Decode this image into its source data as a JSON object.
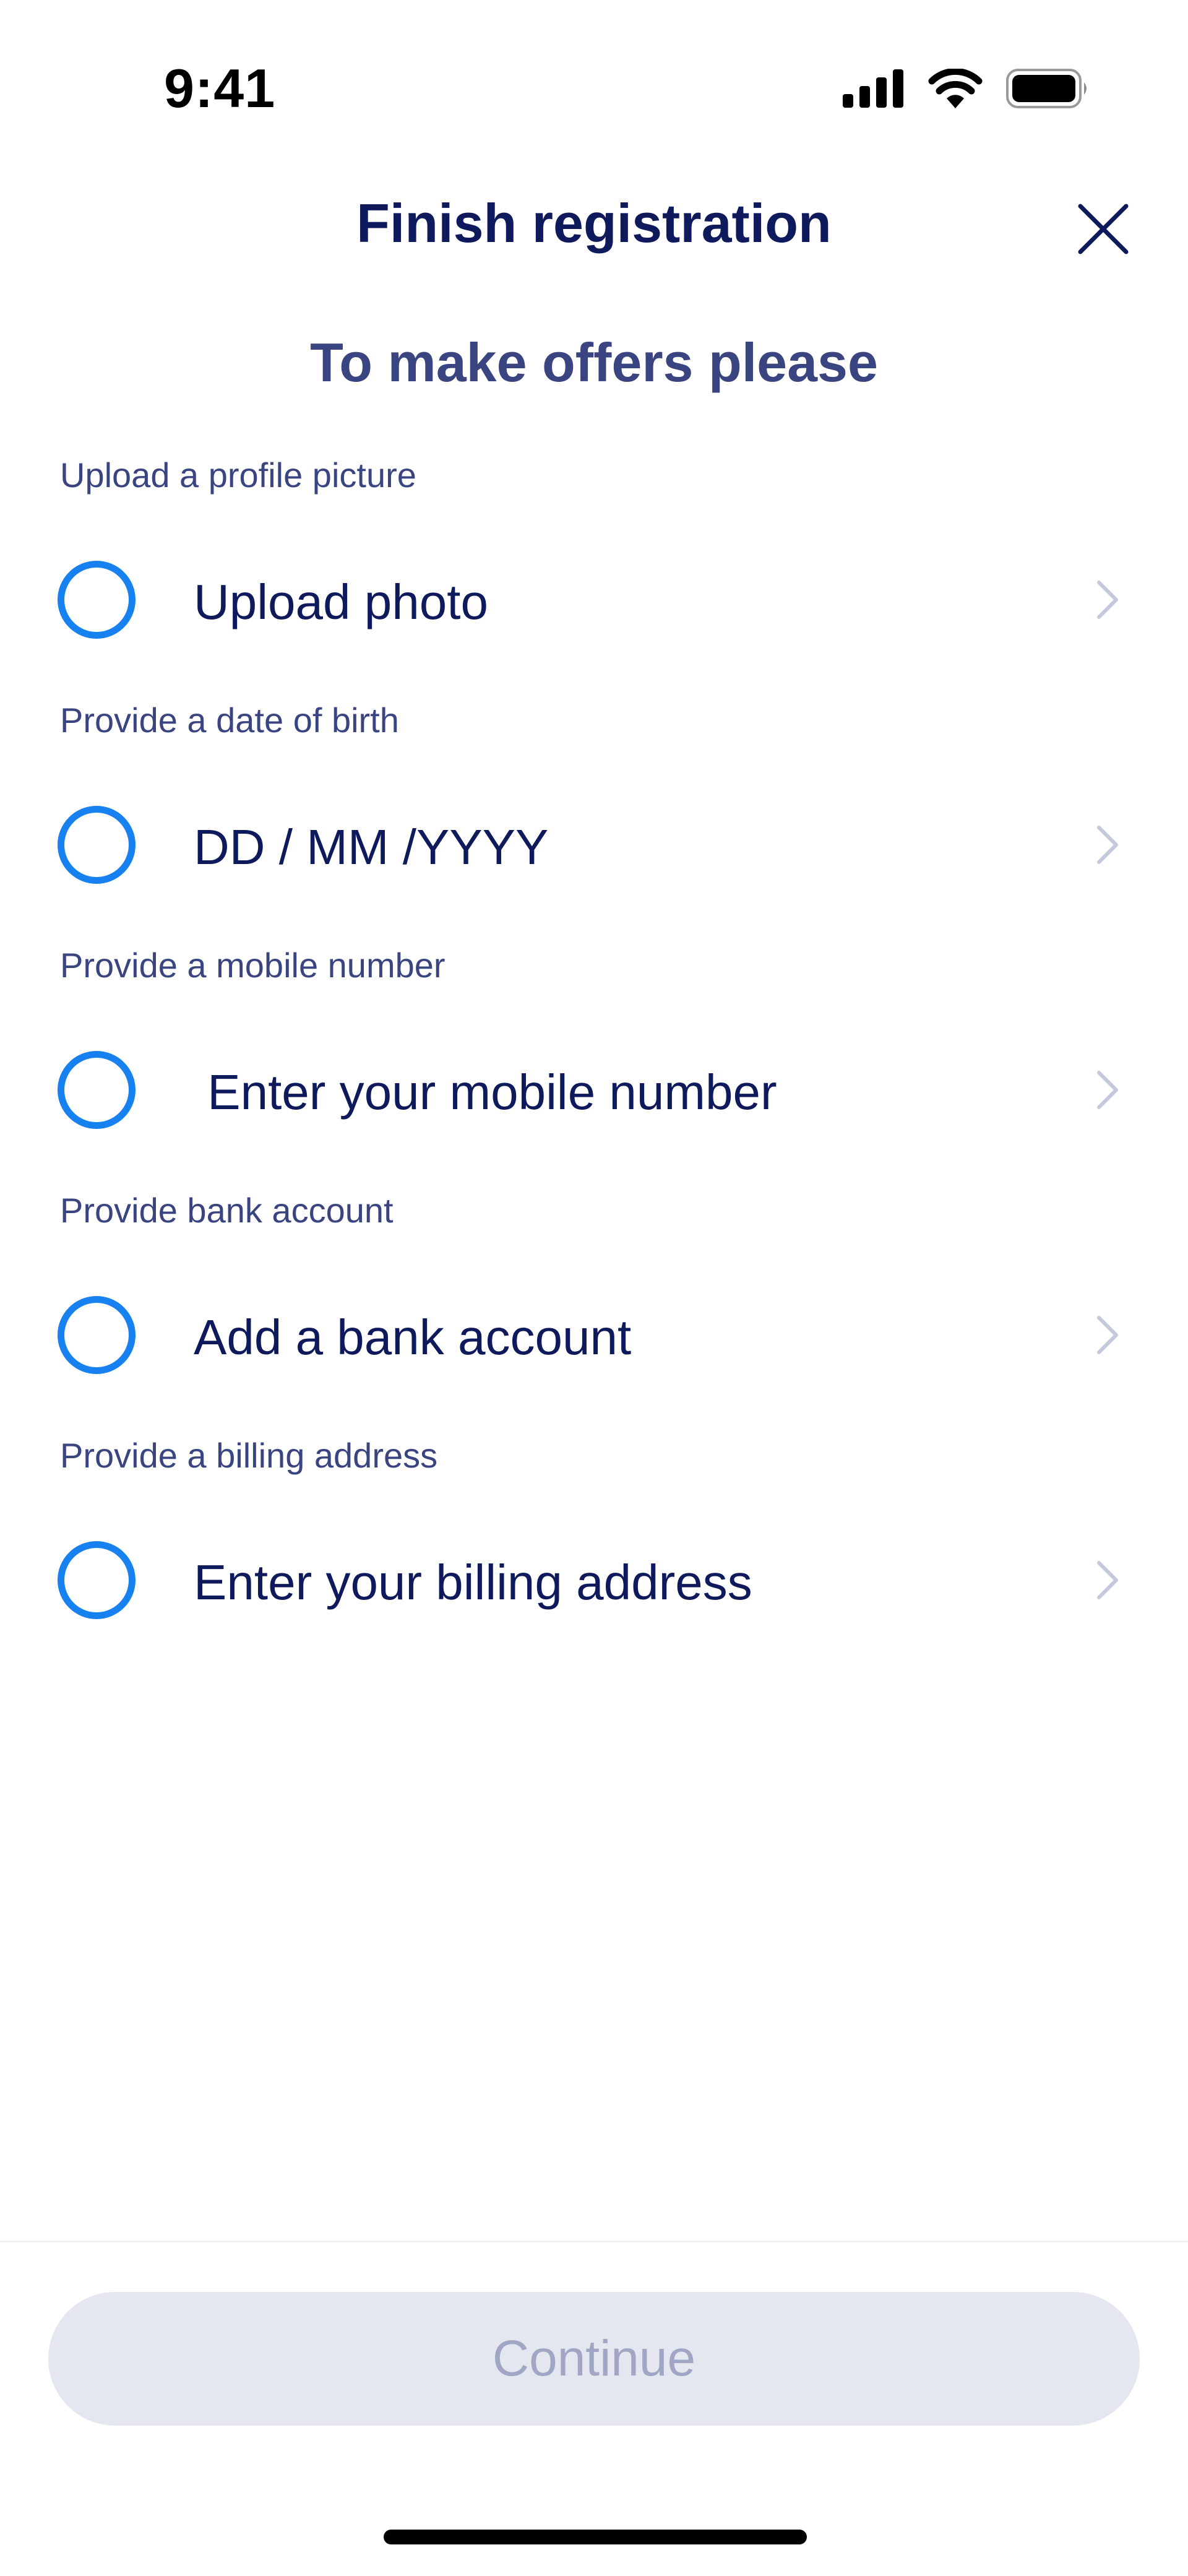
{
  "status_bar": {
    "time": "9:41",
    "icons": [
      "cellular-signal-icon",
      "wifi-icon",
      "battery-icon"
    ]
  },
  "header": {
    "title": "Finish registration",
    "close_icon": "close-icon"
  },
  "subtitle": "To make offers please",
  "sections": [
    {
      "label": "Upload a profile picture",
      "row": "Upload photo"
    },
    {
      "label": "Provide a date of birth",
      "row": "DD / MM /YYYY"
    },
    {
      "label": "Provide a mobile number",
      "row": " Enter your mobile number"
    },
    {
      "label": "Provide bank account",
      "row": "Add a bank account"
    },
    {
      "label": "Provide a billing address",
      "row": "Enter your billing address"
    }
  ],
  "footer": {
    "continue_label": "Continue",
    "continue_enabled": false
  },
  "colors": {
    "title": "#0f1a5c",
    "subtitle": "#3a4480",
    "radio_accent": "#1781f0",
    "chevron": "#c5c9dc",
    "button_disabled_bg": "#e5e7f0",
    "button_disabled_text": "#a0a6c4"
  }
}
